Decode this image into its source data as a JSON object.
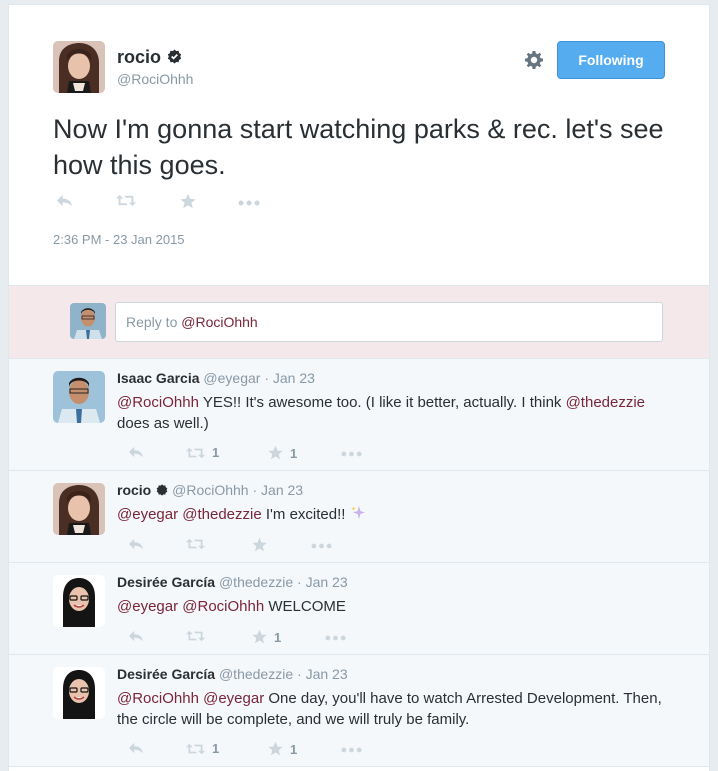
{
  "tweet": {
    "author_name": "rocio",
    "author_handle": "@RociOhhh",
    "text": "Now I'm gonna start watching parks & rec. let's see how this goes.",
    "timestamp": "2:36 PM - 23 Jan 2015",
    "follow_label": "Following"
  },
  "reply_box": {
    "prefix": "Reply to ",
    "mention": "@RociOhhh"
  },
  "replies": [
    {
      "name": "Isaac Garcia",
      "handle": "@eyegar",
      "date": "Jan 23",
      "mention1": "@RociOhhh",
      "text1": " YES!! It's awesome too. (I like it better, actually. I think ",
      "mention2": "@thedezzie",
      "text2": " does as well.)",
      "retweets": "1",
      "favorites": "1"
    },
    {
      "name": "rocio",
      "handle": "@RociOhhh",
      "date": "Jan 23",
      "mention1": "@eyegar",
      "mention2": "@thedezzie",
      "text": " I'm excited!! "
    },
    {
      "name": "Desirée García",
      "handle": "@thedezzie",
      "date": "Jan 23",
      "mention1": "@eyegar",
      "mention2": "@RociOhhh",
      "text": " WELCOME",
      "favorites": "1"
    },
    {
      "name": "Desirée García",
      "handle": "@thedezzie",
      "date": "Jan 23",
      "mention1": "@RociOhhh",
      "mention2": "@eyegar",
      "text": " One day, you'll have to watch Arrested Development. Then, the circle will be complete, and we will truly be family.",
      "retweets": "1",
      "favorites": "1"
    }
  ],
  "separator": " · ",
  "icons": [
    "verified-badge-icon",
    "gear-icon",
    "reply-icon",
    "retweet-icon",
    "favorite-star-icon",
    "more-icon",
    "sparkles-icon"
  ],
  "colors": {
    "accent": "#55acee",
    "mention": "#7a2539",
    "reply_box_bg": "#f5e8eb",
    "reply_bg": "#f5f8fa",
    "muted": "#8899a6",
    "icon": "#ccd6dd"
  }
}
